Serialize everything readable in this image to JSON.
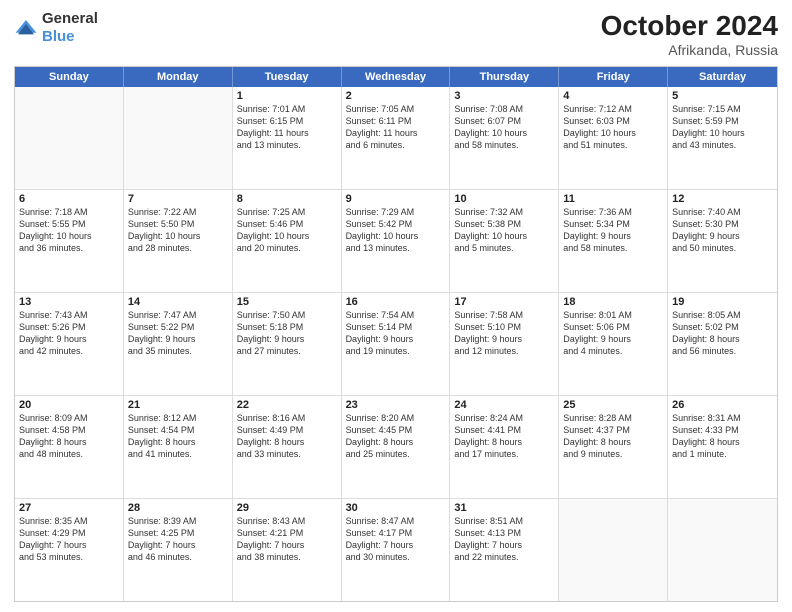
{
  "header": {
    "logo": {
      "general": "General",
      "blue": "Blue"
    },
    "title": "October 2024",
    "location": "Afrikanda, Russia"
  },
  "days_of_week": [
    "Sunday",
    "Monday",
    "Tuesday",
    "Wednesday",
    "Thursday",
    "Friday",
    "Saturday"
  ],
  "rows": [
    {
      "cells": [
        {
          "day": "",
          "empty": true,
          "lines": []
        },
        {
          "day": "",
          "empty": true,
          "lines": []
        },
        {
          "day": "1",
          "empty": false,
          "lines": [
            "Sunrise: 7:01 AM",
            "Sunset: 6:15 PM",
            "Daylight: 11 hours",
            "and 13 minutes."
          ]
        },
        {
          "day": "2",
          "empty": false,
          "lines": [
            "Sunrise: 7:05 AM",
            "Sunset: 6:11 PM",
            "Daylight: 11 hours",
            "and 6 minutes."
          ]
        },
        {
          "day": "3",
          "empty": false,
          "lines": [
            "Sunrise: 7:08 AM",
            "Sunset: 6:07 PM",
            "Daylight: 10 hours",
            "and 58 minutes."
          ]
        },
        {
          "day": "4",
          "empty": false,
          "lines": [
            "Sunrise: 7:12 AM",
            "Sunset: 6:03 PM",
            "Daylight: 10 hours",
            "and 51 minutes."
          ]
        },
        {
          "day": "5",
          "empty": false,
          "lines": [
            "Sunrise: 7:15 AM",
            "Sunset: 5:59 PM",
            "Daylight: 10 hours",
            "and 43 minutes."
          ]
        }
      ]
    },
    {
      "cells": [
        {
          "day": "6",
          "empty": false,
          "lines": [
            "Sunrise: 7:18 AM",
            "Sunset: 5:55 PM",
            "Daylight: 10 hours",
            "and 36 minutes."
          ]
        },
        {
          "day": "7",
          "empty": false,
          "lines": [
            "Sunrise: 7:22 AM",
            "Sunset: 5:50 PM",
            "Daylight: 10 hours",
            "and 28 minutes."
          ]
        },
        {
          "day": "8",
          "empty": false,
          "lines": [
            "Sunrise: 7:25 AM",
            "Sunset: 5:46 PM",
            "Daylight: 10 hours",
            "and 20 minutes."
          ]
        },
        {
          "day": "9",
          "empty": false,
          "lines": [
            "Sunrise: 7:29 AM",
            "Sunset: 5:42 PM",
            "Daylight: 10 hours",
            "and 13 minutes."
          ]
        },
        {
          "day": "10",
          "empty": false,
          "lines": [
            "Sunrise: 7:32 AM",
            "Sunset: 5:38 PM",
            "Daylight: 10 hours",
            "and 5 minutes."
          ]
        },
        {
          "day": "11",
          "empty": false,
          "lines": [
            "Sunrise: 7:36 AM",
            "Sunset: 5:34 PM",
            "Daylight: 9 hours",
            "and 58 minutes."
          ]
        },
        {
          "day": "12",
          "empty": false,
          "lines": [
            "Sunrise: 7:40 AM",
            "Sunset: 5:30 PM",
            "Daylight: 9 hours",
            "and 50 minutes."
          ]
        }
      ]
    },
    {
      "cells": [
        {
          "day": "13",
          "empty": false,
          "lines": [
            "Sunrise: 7:43 AM",
            "Sunset: 5:26 PM",
            "Daylight: 9 hours",
            "and 42 minutes."
          ]
        },
        {
          "day": "14",
          "empty": false,
          "lines": [
            "Sunrise: 7:47 AM",
            "Sunset: 5:22 PM",
            "Daylight: 9 hours",
            "and 35 minutes."
          ]
        },
        {
          "day": "15",
          "empty": false,
          "lines": [
            "Sunrise: 7:50 AM",
            "Sunset: 5:18 PM",
            "Daylight: 9 hours",
            "and 27 minutes."
          ]
        },
        {
          "day": "16",
          "empty": false,
          "lines": [
            "Sunrise: 7:54 AM",
            "Sunset: 5:14 PM",
            "Daylight: 9 hours",
            "and 19 minutes."
          ]
        },
        {
          "day": "17",
          "empty": false,
          "lines": [
            "Sunrise: 7:58 AM",
            "Sunset: 5:10 PM",
            "Daylight: 9 hours",
            "and 12 minutes."
          ]
        },
        {
          "day": "18",
          "empty": false,
          "lines": [
            "Sunrise: 8:01 AM",
            "Sunset: 5:06 PM",
            "Daylight: 9 hours",
            "and 4 minutes."
          ]
        },
        {
          "day": "19",
          "empty": false,
          "lines": [
            "Sunrise: 8:05 AM",
            "Sunset: 5:02 PM",
            "Daylight: 8 hours",
            "and 56 minutes."
          ]
        }
      ]
    },
    {
      "cells": [
        {
          "day": "20",
          "empty": false,
          "lines": [
            "Sunrise: 8:09 AM",
            "Sunset: 4:58 PM",
            "Daylight: 8 hours",
            "and 48 minutes."
          ]
        },
        {
          "day": "21",
          "empty": false,
          "lines": [
            "Sunrise: 8:12 AM",
            "Sunset: 4:54 PM",
            "Daylight: 8 hours",
            "and 41 minutes."
          ]
        },
        {
          "day": "22",
          "empty": false,
          "lines": [
            "Sunrise: 8:16 AM",
            "Sunset: 4:49 PM",
            "Daylight: 8 hours",
            "and 33 minutes."
          ]
        },
        {
          "day": "23",
          "empty": false,
          "lines": [
            "Sunrise: 8:20 AM",
            "Sunset: 4:45 PM",
            "Daylight: 8 hours",
            "and 25 minutes."
          ]
        },
        {
          "day": "24",
          "empty": false,
          "lines": [
            "Sunrise: 8:24 AM",
            "Sunset: 4:41 PM",
            "Daylight: 8 hours",
            "and 17 minutes."
          ]
        },
        {
          "day": "25",
          "empty": false,
          "lines": [
            "Sunrise: 8:28 AM",
            "Sunset: 4:37 PM",
            "Daylight: 8 hours",
            "and 9 minutes."
          ]
        },
        {
          "day": "26",
          "empty": false,
          "lines": [
            "Sunrise: 8:31 AM",
            "Sunset: 4:33 PM",
            "Daylight: 8 hours",
            "and 1 minute."
          ]
        }
      ]
    },
    {
      "cells": [
        {
          "day": "27",
          "empty": false,
          "lines": [
            "Sunrise: 8:35 AM",
            "Sunset: 4:29 PM",
            "Daylight: 7 hours",
            "and 53 minutes."
          ]
        },
        {
          "day": "28",
          "empty": false,
          "lines": [
            "Sunrise: 8:39 AM",
            "Sunset: 4:25 PM",
            "Daylight: 7 hours",
            "and 46 minutes."
          ]
        },
        {
          "day": "29",
          "empty": false,
          "lines": [
            "Sunrise: 8:43 AM",
            "Sunset: 4:21 PM",
            "Daylight: 7 hours",
            "and 38 minutes."
          ]
        },
        {
          "day": "30",
          "empty": false,
          "lines": [
            "Sunrise: 8:47 AM",
            "Sunset: 4:17 PM",
            "Daylight: 7 hours",
            "and 30 minutes."
          ]
        },
        {
          "day": "31",
          "empty": false,
          "lines": [
            "Sunrise: 8:51 AM",
            "Sunset: 4:13 PM",
            "Daylight: 7 hours",
            "and 22 minutes."
          ]
        },
        {
          "day": "",
          "empty": true,
          "lines": []
        },
        {
          "day": "",
          "empty": true,
          "lines": []
        }
      ]
    }
  ]
}
